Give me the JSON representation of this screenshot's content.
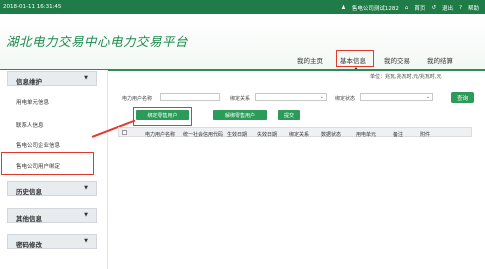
{
  "topbar": {
    "date": "2018-01-11 16:31:45",
    "user": "售电公司测试1282",
    "home": "首页",
    "logout": "退出",
    "help": "帮助"
  },
  "header": {
    "title": "湖北电力交易中心电力交易平台"
  },
  "nav": {
    "items": [
      "我的主页",
      "基本信息",
      "我的交易",
      "我的结算"
    ],
    "active_index": 1
  },
  "unit_text": "单位：兆瓦,兆瓦时,元/兆瓦时,元",
  "sidebar": {
    "sections": [
      {
        "label": "信息维护",
        "items": [
          "用电单元信息",
          "联系人信息",
          "售电公司企业信息",
          "售电公司用户绑定"
        ]
      },
      {
        "label": "历史信息"
      },
      {
        "label": "其他信息"
      },
      {
        "label": "密码修改"
      }
    ],
    "active_item": "售电公司用户绑定"
  },
  "filters": {
    "user_name_label": "电力用户名称",
    "binding_relation_label": "绑定关系",
    "binding_status_label": "绑定状态",
    "query_label": "查询"
  },
  "actions": {
    "bind_label": "绑定零售用户",
    "unbind_label": "解绑零售用户",
    "submit_label": "提交"
  },
  "table": {
    "headers": [
      "电力用户名称",
      "统一社会信用代码",
      "生效日期",
      "失效日期",
      "绑定关系",
      "数据状态",
      "用电单元",
      "备注",
      "附件"
    ]
  },
  "colors": {
    "brand_green": "#1f7c47",
    "button_green": "#2c9a59",
    "highlight_red": "#e03a2e"
  }
}
